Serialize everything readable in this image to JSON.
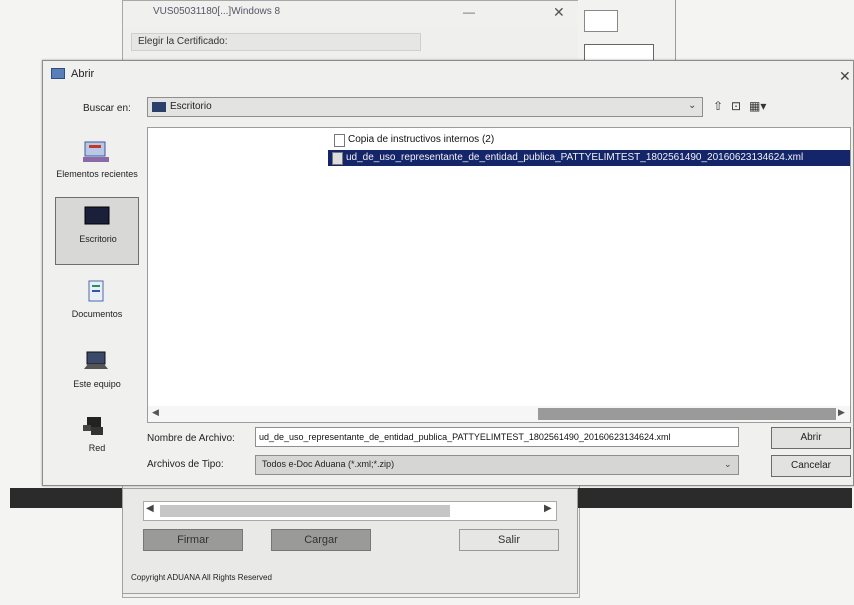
{
  "background_window": {
    "title": "VUS05031180[...]Windows 8",
    "minimize": "—",
    "close": "✕",
    "cert_label": "Elegir la Certificado:",
    "buttons": [
      "Firmar",
      "Cargar",
      "Salir"
    ],
    "copyright": "Copyright ADUANA All Rights Reserved"
  },
  "dialog": {
    "title": "Abrir",
    "close": "✕",
    "look_in": {
      "label": "Buscar en:",
      "value": "Escritorio",
      "arrow": "⌄"
    },
    "toolbar": {
      "up": "⇧",
      "new_folder": "⊡",
      "view": "▦▾"
    },
    "places": [
      {
        "label": "Elementos recientes",
        "icon": "recent-items-icon"
      },
      {
        "label": "Escritorio",
        "icon": "desktop-icon"
      },
      {
        "label": "Documentos",
        "icon": "documents-icon"
      },
      {
        "label": "Este equipo",
        "icon": "computer-icon"
      },
      {
        "label": "Red",
        "icon": "network-icon"
      }
    ],
    "files": [
      {
        "name": "Copia de instructivos internos (2)",
        "selected": false
      },
      {
        "name": "ud_de_uso_representante_de_entidad_publica_PATTYELIMTEST_1802561490_20160623134624.xml",
        "selected": true
      }
    ],
    "scroll": {
      "left": "◀",
      "right": "▶"
    },
    "file_name": {
      "label": "Nombre de Archivo:",
      "value": "ud_de_uso_representante_de_entidad_publica_PATTYELIMTEST_1802561490_20160623134624.xml"
    },
    "file_type": {
      "label": "Archivos de Tipo:",
      "value": "Todos e-Doc Aduana (*.xml;*.zip)",
      "arrow": "⌄"
    },
    "open_button": "Abrir",
    "cancel_button": "Cancelar"
  },
  "colors": {
    "selection": "#14256a",
    "dialog_bg": "#f0f0ee",
    "dark_band": "#2b2b2b"
  }
}
